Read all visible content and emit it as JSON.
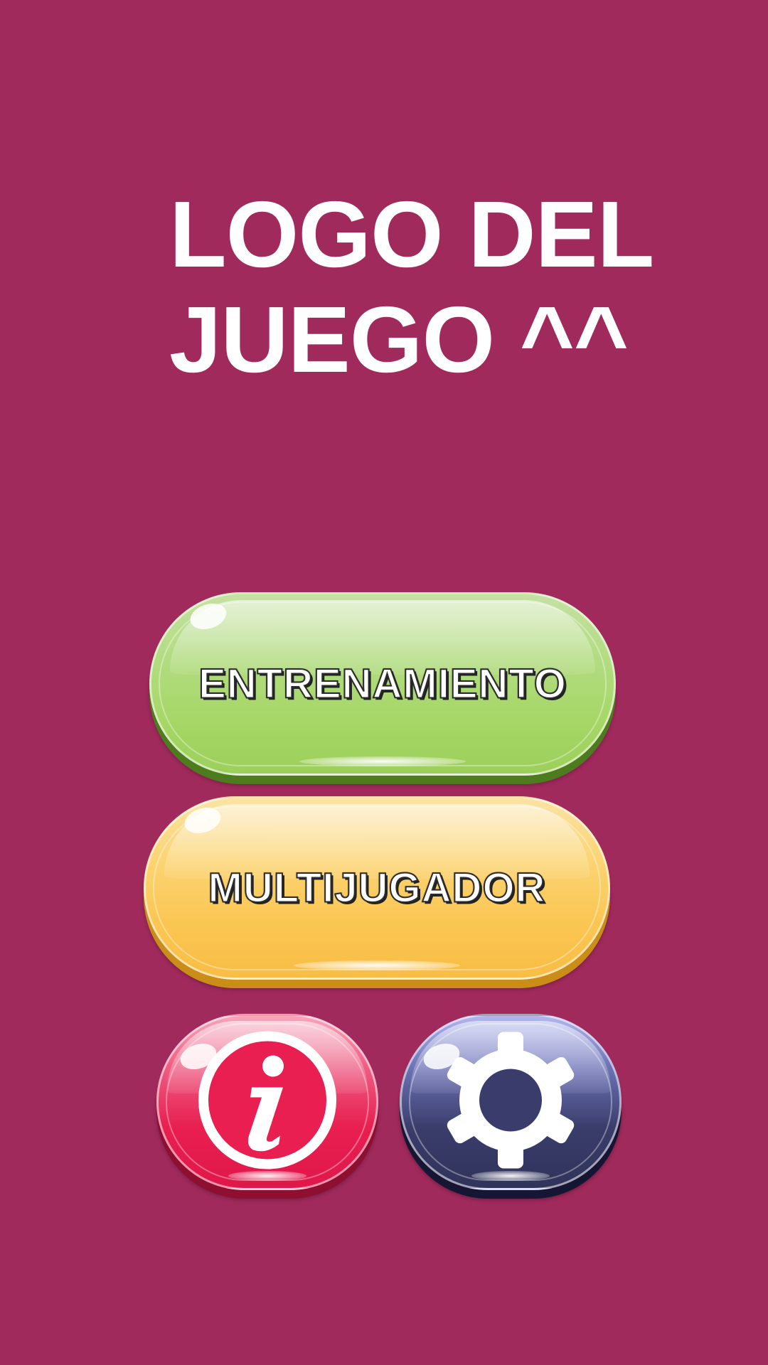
{
  "logo": {
    "line1": "LOGO DEL",
    "line2": "JUEGO ^^"
  },
  "menu": {
    "training_label": "ENTRENAMIENTO",
    "multiplayer_label": "MULTIJUGADOR",
    "info_icon": "info-icon",
    "settings_icon": "gear-icon"
  },
  "colors": {
    "background": "#a12a5d",
    "training": "#a6d767",
    "multiplayer": "#fac652",
    "info": "#e81f50",
    "settings": "#3a3d6b"
  }
}
